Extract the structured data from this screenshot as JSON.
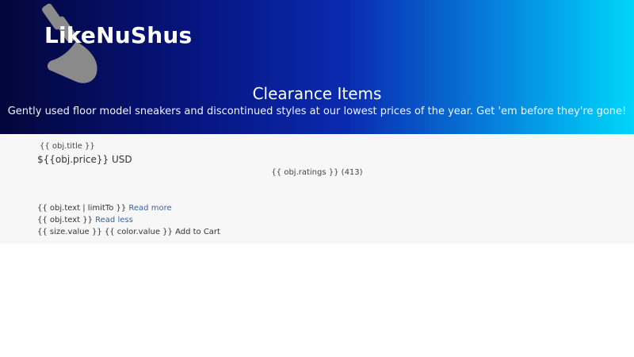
{
  "header": {
    "brand": "LikeNuShus",
    "title": "Clearance Items",
    "subtitle": "Gently used floor model sneakers and discontinued styles at our lowest prices of the year. Get 'em before they're gone!"
  },
  "product": {
    "title": "{{ obj.title }}",
    "price": "${{obj.price}} USD",
    "ratings": "{{ obj.ratings }} (413)",
    "text_short": "{{ obj.text | limitTo }}",
    "read_more": "Read more",
    "text_full": "{{ obj.text }}",
    "read_less": "Read less",
    "options": "{{ size.value }} {{ color.value }}",
    "add_to_cart": "Add to Cart"
  },
  "colors": {
    "gradient_start": "#03063a",
    "gradient_end": "#00d6fb",
    "link": "#3a5fa6",
    "content_bg": "#f7f7f7"
  },
  "icons": {
    "logo": "sneaker-icon"
  }
}
